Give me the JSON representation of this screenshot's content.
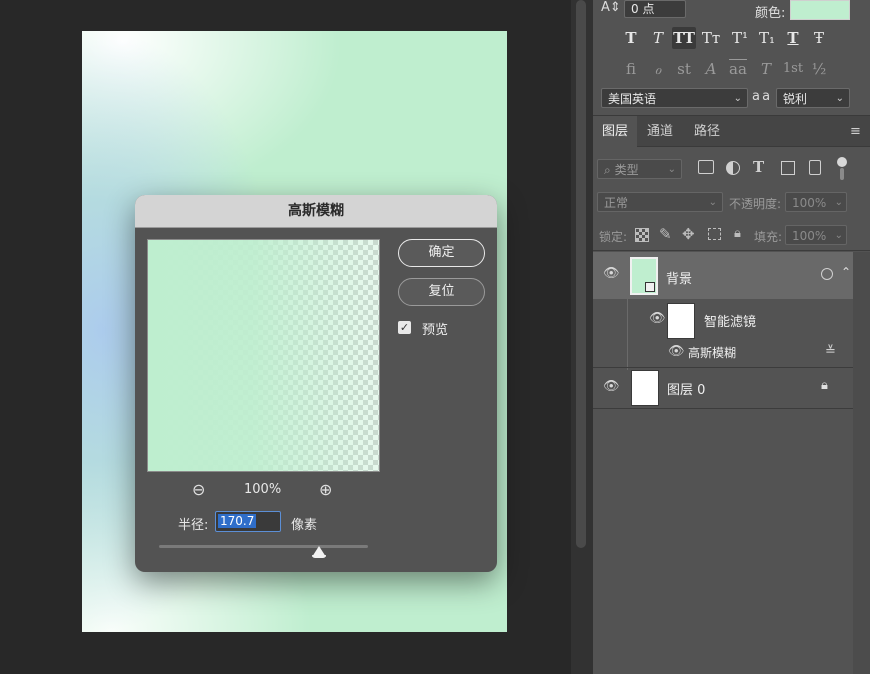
{
  "character_panel": {
    "size_value": "0 点",
    "color_label": "颜色:",
    "color_swatch": "#bfeecf",
    "style_buttons": [
      "T",
      "T",
      "TT",
      "Tт",
      "T¹",
      "T₁",
      "T",
      "Ŧ"
    ],
    "opentype_buttons": [
      "fi",
      "ℴ",
      "st",
      "A",
      "aa",
      "T",
      "1st",
      "½"
    ],
    "language": "美国英语",
    "aa_icon_label": "a a",
    "antialias": "锐利"
  },
  "layers_panel": {
    "tabs": [
      "图层",
      "通道",
      "路径"
    ],
    "filter_kind": "类型",
    "blend_mode": "正常",
    "opacity_label": "不透明度:",
    "opacity_value": "100%",
    "lock_label": "锁定:",
    "fill_label": "填充:",
    "fill_value": "100%",
    "layers": [
      {
        "name": "背景",
        "thumb_color": "#bfeecf"
      },
      {
        "name": "智能滤镜"
      },
      {
        "name": "高斯模糊"
      },
      {
        "name": "图层 0"
      }
    ]
  },
  "dialog": {
    "title": "高斯模糊",
    "ok_label": "确定",
    "reset_label": "复位",
    "preview_label": "预览",
    "preview_checked": true,
    "zoom_value": "100%",
    "radius_label": "半径:",
    "radius_value": "170.7",
    "radius_unit": "像素"
  }
}
